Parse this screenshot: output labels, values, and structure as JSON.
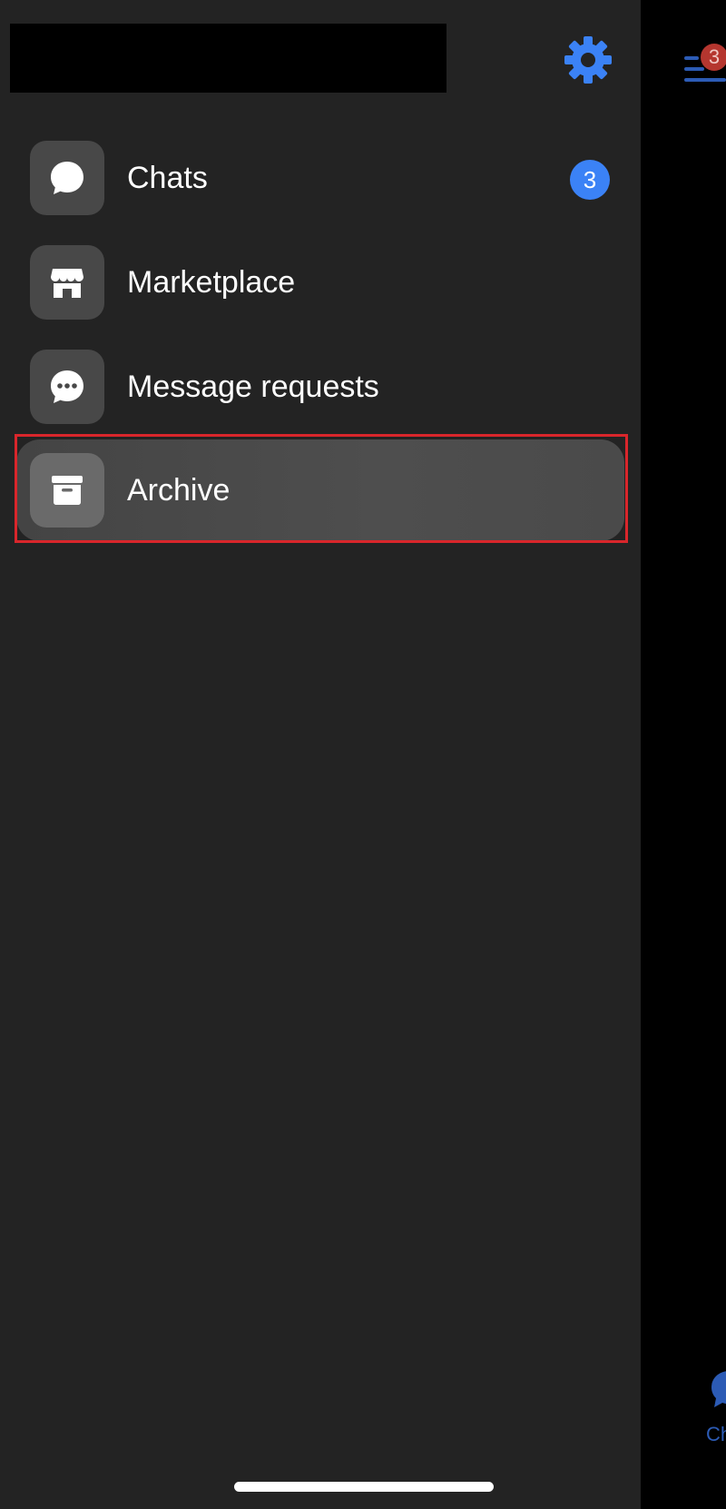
{
  "colors": {
    "drawer_background": "#232323",
    "accent_blue": "#3b82f6",
    "selected_item": "#4a4a4a",
    "icon_tile": "#484848",
    "highlight_outline": "#d9262b",
    "peek_badge": "#b5362f"
  },
  "header": {
    "profile_name": "",
    "settings_icon": "gear-icon"
  },
  "menu": {
    "items": [
      {
        "label": "Chats",
        "icon": "chat-bubble-icon",
        "badge": "3",
        "selected": false
      },
      {
        "label": "Marketplace",
        "icon": "storefront-icon",
        "badge": "",
        "selected": false
      },
      {
        "label": "Message requests",
        "icon": "message-requests-icon",
        "badge": "",
        "selected": false
      },
      {
        "label": "Archive",
        "icon": "archive-box-icon",
        "badge": "",
        "selected": true
      }
    ]
  },
  "background_screen": {
    "menu_icon": "hamburger-menu-icon",
    "menu_badge": "3",
    "tab_icon": "chat-bubble-icon",
    "tab_label_partial": "Ch"
  }
}
